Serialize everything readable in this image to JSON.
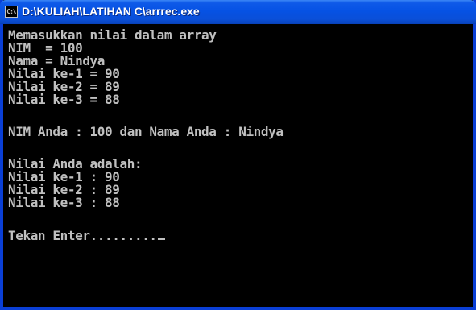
{
  "window": {
    "title": "D:\\KULIAH\\LATIHAN C\\arrrec.exe",
    "icon_label": "C:\\"
  },
  "console": {
    "lines": [
      "Memasukkan nilai dalam array",
      "NIM  = 100",
      "Nama = Nindya",
      "Nilai ke-1 = 90",
      "Nilai ke-2 = 89",
      "Nilai ke-3 = 88",
      "",
      "NIM Anda : 100 dan Nama Anda : Nindya",
      "",
      "Nilai Anda adalah:",
      "Nilai ke-1 : 90",
      "Nilai ke-2 : 89",
      "Nilai ke-3 : 88",
      "",
      "Tekan Enter........."
    ]
  },
  "colors": {
    "title_bar": "#0652e4",
    "console_background": "#000000",
    "console_text": "#c0c0c0"
  }
}
